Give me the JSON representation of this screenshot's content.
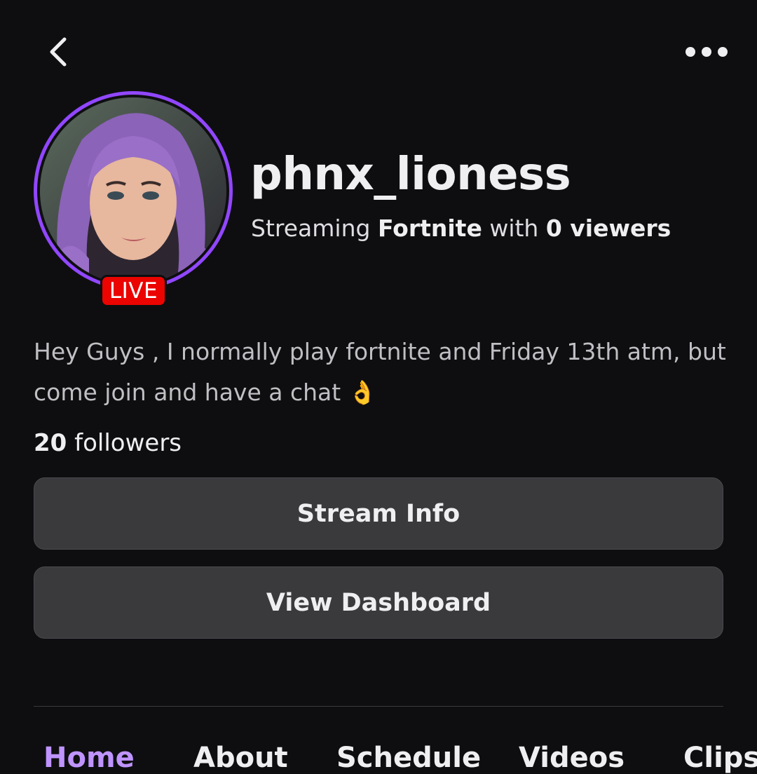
{
  "header": {
    "back_icon": "chevron-left-icon",
    "more_icon": "more-horizontal-icon"
  },
  "profile": {
    "username": "phnx_lioness",
    "live_badge": "LIVE",
    "streaming_prefix": "Streaming",
    "game": "Fortnite",
    "streaming_mid": "with",
    "viewers": "0 viewers",
    "bio": "Hey Guys , I normally play fortnite and Friday 13th atm, but come join and have a chat 👌",
    "followers_count": "20",
    "followers_label": "followers"
  },
  "buttons": {
    "stream_info": "Stream Info",
    "view_dashboard": "View Dashboard"
  },
  "tabs": [
    {
      "label": "Home"
    },
    {
      "label": "About"
    },
    {
      "label": "Schedule"
    },
    {
      "label": "Videos"
    },
    {
      "label": "Clips"
    }
  ],
  "colors": {
    "background": "#0e0e10",
    "accent": "#9147ff",
    "live": "#eb0400",
    "button": "#3a3a3d"
  }
}
